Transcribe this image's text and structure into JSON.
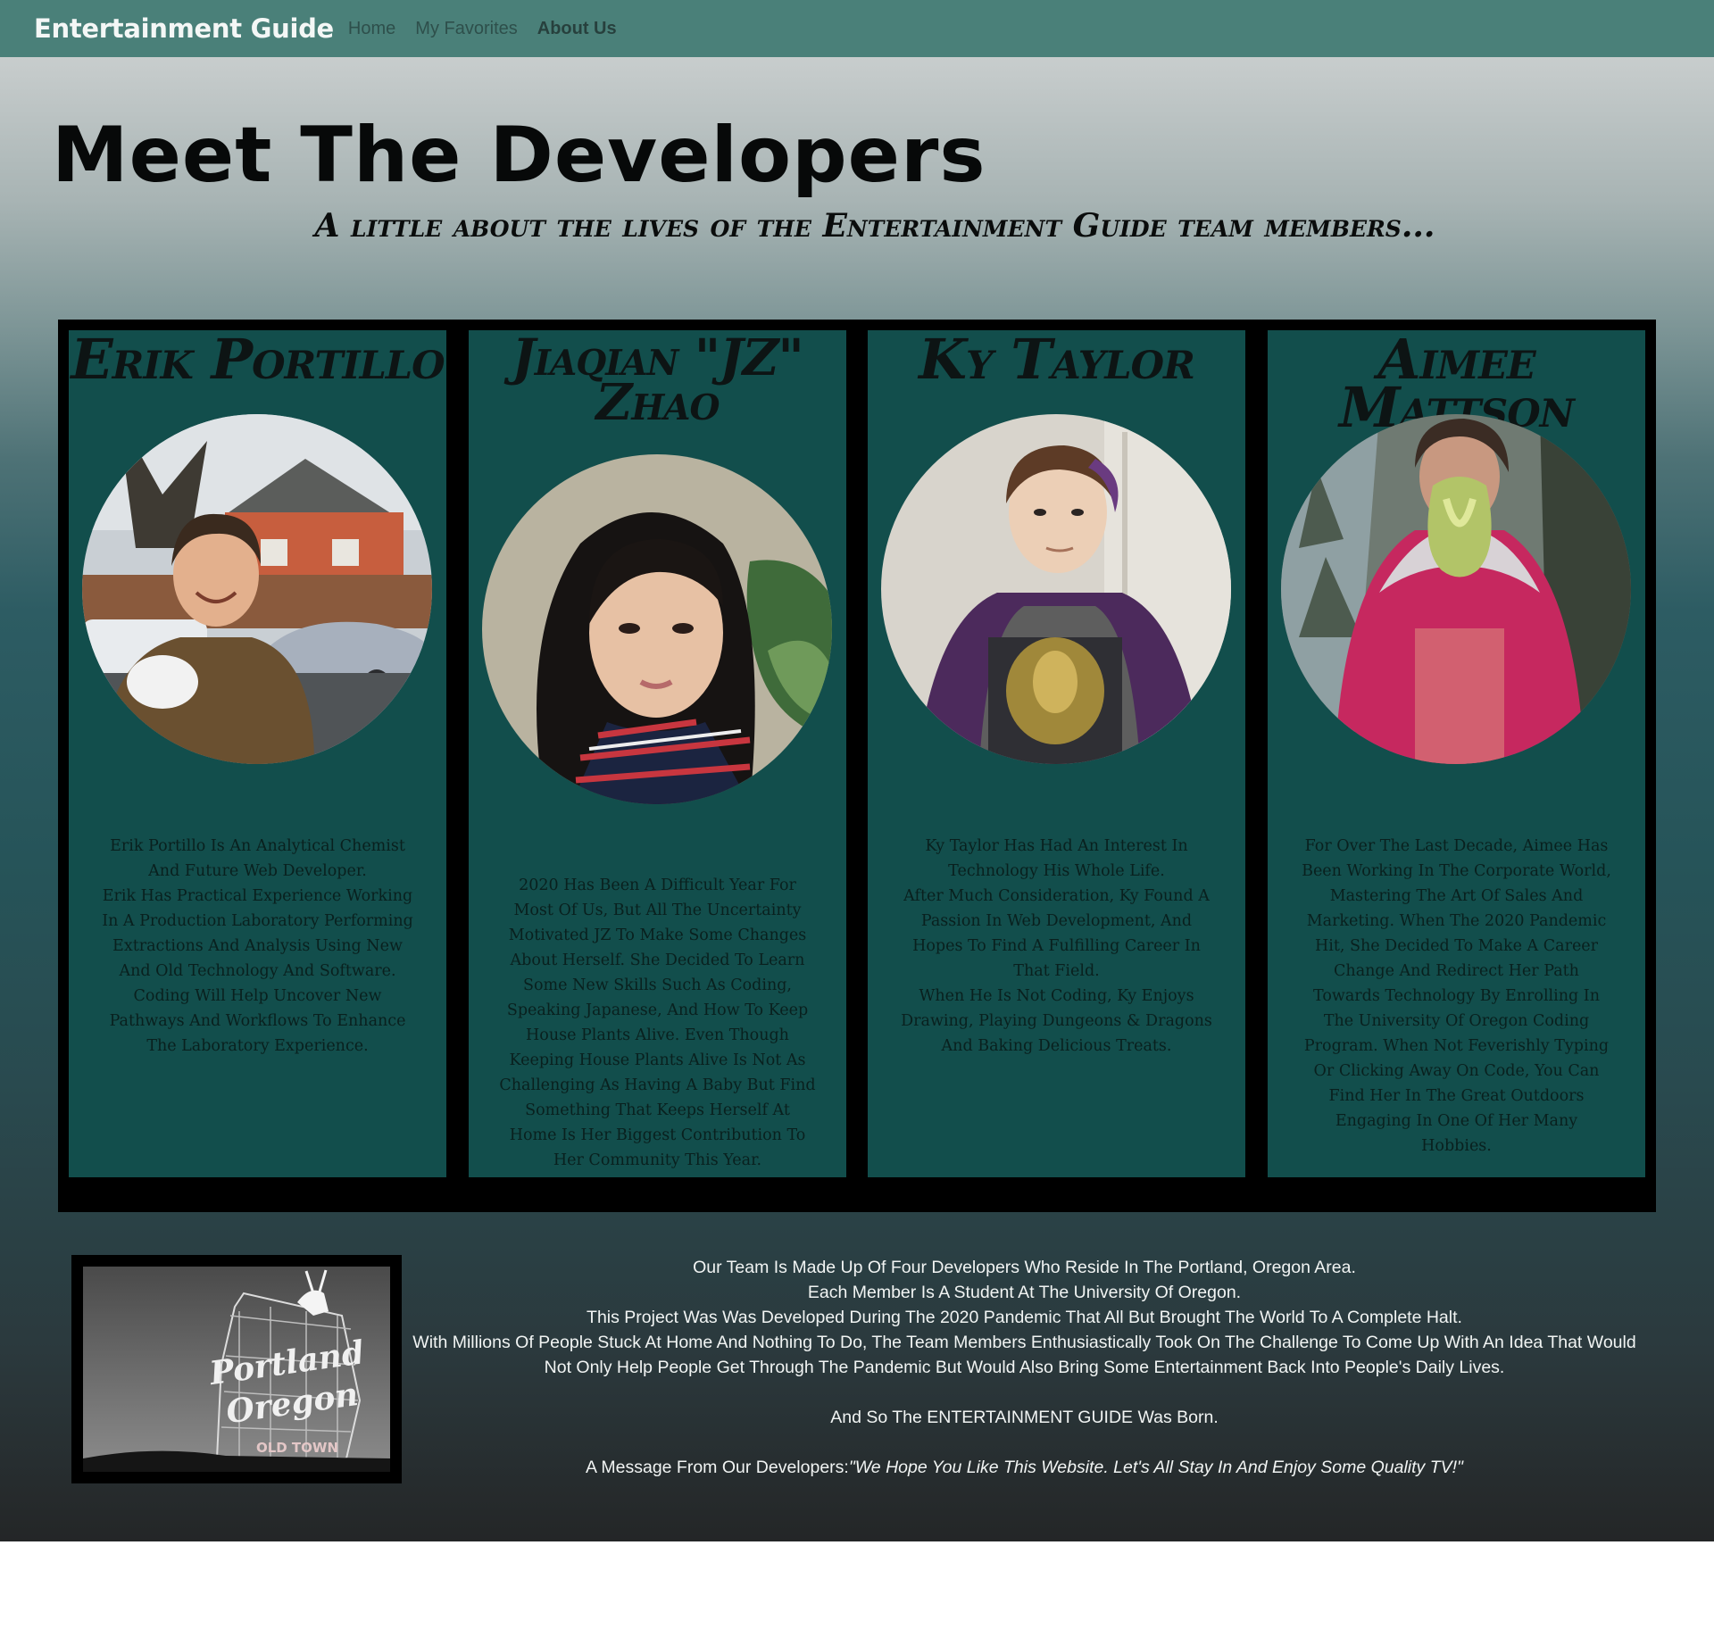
{
  "navbar": {
    "brand": "Entertainment Guide",
    "links": [
      {
        "label": "Home",
        "active": false
      },
      {
        "label": "My Favorites",
        "active": false
      },
      {
        "label": "About Us",
        "active": true
      }
    ]
  },
  "hero": {
    "title": "Meet The Developers",
    "subtitle": "A little about the lives of the Entertainment Guide team members..."
  },
  "colors": {
    "navbar": "#4a8079",
    "card": "#124e4c",
    "frame": "#000000"
  },
  "developers": [
    {
      "name": "Erik Portillo",
      "photo_icon": "erik-photo",
      "bio": [
        "Erik Portillo Is An Analytical Chemist And Future Web Developer.",
        "Erik Has Practical Experience Working In A Production Laboratory Performing Extractions And Analysis Using New And Old Technology And Software.",
        "Coding Will Help Uncover New Pathways And Workflows To Enhance The Laboratory Experience."
      ]
    },
    {
      "name": "Jiaqian \"JZ\" Zhao",
      "photo_icon": "jz-photo",
      "bio": [
        "2020 Has Been A Difficult Year For Most Of Us, But All The Uncertainty Motivated JZ To Make Some Changes About Herself. She Decided To Learn Some New Skills Such As Coding, Speaking Japanese, And How To Keep House Plants Alive. Even Though Keeping House Plants Alive Is Not As Challenging As Having A Baby But Find Something That Keeps Herself At Home Is Her Biggest Contribution To Her Community This Year."
      ]
    },
    {
      "name": "Ky Taylor",
      "photo_icon": "ky-photo",
      "bio": [
        "Ky Taylor Has Had An Interest In Technology His Whole Life.",
        "After Much Consideration, Ky Found A Passion In Web Development, And Hopes To Find A Fulfilling Career In That Field.",
        "When He Is Not Coding, Ky Enjoys Drawing, Playing Dungeons & Dragons And Baking Delicious Treats."
      ]
    },
    {
      "name": "Aimee Mattson",
      "photo_icon": "aimee-photo",
      "bio": [
        "For Over The Last Decade, Aimee Has Been Working In The Corporate World, Mastering The Art Of Sales And Marketing. When The 2020 Pandemic Hit, She Decided To Make A Career Change And Redirect Her Path Towards Technology By Enrolling In The University Of Oregon Coding Program. When Not Feverishly Typing Or Clicking Away On Code, You Can Find Her In The Great Outdoors Engaging In One Of Her Many Hobbies."
      ]
    }
  ],
  "portland_sign": {
    "line1": "Portland",
    "line2": "Oregon",
    "line3": "OLD TOWN"
  },
  "about": {
    "lines": [
      "Our Team Is Made Up Of Four Developers Who Reside In The Portland, Oregon Area.",
      "Each Member Is A Student At The University Of Oregon.",
      "This Project Was Was Developed During The 2020 Pandemic That All But Brought The World To A Complete Halt.",
      "With Millions Of People Stuck At Home And Nothing To Do, The Team Members Enthusiastically Took On The Challenge To Come Up With An Idea That Would Not Only Help People Get Through The Pandemic But Would Also Bring Some Entertainment Back Into People's Daily Lives."
    ],
    "born": "And So The ENTERTAINMENT GUIDE Was Born.",
    "message_label": "A Message From Our Developers:",
    "message_quote": "\"We Hope You Like This Website. Let's All Stay In And Enjoy Some Quality TV!\""
  }
}
